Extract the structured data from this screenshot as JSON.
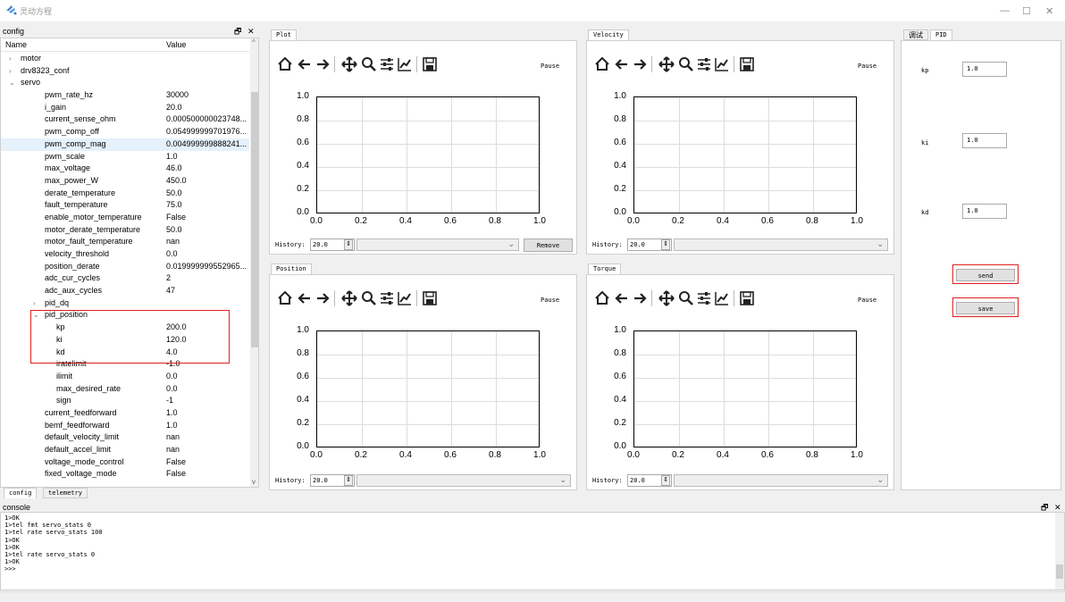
{
  "window": {
    "title": "灵动方程",
    "minimize": "—",
    "maximize": "☐",
    "close": "✕"
  },
  "config": {
    "dock_title": "config",
    "float_icon": "🗗",
    "close_icon": "✕",
    "col_name": "Name",
    "col_value": "Value",
    "rows": [
      {
        "k": "motor",
        "v": "",
        "lvl": 1,
        "arrow": ">"
      },
      {
        "k": "drv8323_conf",
        "v": "",
        "lvl": 1,
        "arrow": ">"
      },
      {
        "k": "servo",
        "v": "",
        "lvl": 1,
        "arrow": "v"
      },
      {
        "k": "pwm_rate_hz",
        "v": "30000",
        "lvl": 2
      },
      {
        "k": "i_gain",
        "v": "20.0",
        "lvl": 2
      },
      {
        "k": "current_sense_ohm",
        "v": "0.000500000023748...",
        "lvl": 2
      },
      {
        "k": "pwm_comp_off",
        "v": "0.054999999701976...",
        "lvl": 2
      },
      {
        "k": "pwm_comp_mag",
        "v": "0.004999999888241...",
        "lvl": 2,
        "sel": true
      },
      {
        "k": "pwm_scale",
        "v": "1.0",
        "lvl": 2
      },
      {
        "k": "max_voltage",
        "v": "46.0",
        "lvl": 2
      },
      {
        "k": "max_power_W",
        "v": "450.0",
        "lvl": 2
      },
      {
        "k": "derate_temperature",
        "v": "50.0",
        "lvl": 2
      },
      {
        "k": "fault_temperature",
        "v": "75.0",
        "lvl": 2
      },
      {
        "k": "enable_motor_temperature",
        "v": "False",
        "lvl": 2
      },
      {
        "k": "motor_derate_temperature",
        "v": "50.0",
        "lvl": 2
      },
      {
        "k": "motor_fault_temperature",
        "v": "nan",
        "lvl": 2
      },
      {
        "k": "velocity_threshold",
        "v": "0.0",
        "lvl": 2
      },
      {
        "k": "position_derate",
        "v": "0.019999999552965...",
        "lvl": 2
      },
      {
        "k": "adc_cur_cycles",
        "v": "2",
        "lvl": 2
      },
      {
        "k": "adc_aux_cycles",
        "v": "47",
        "lvl": 2
      },
      {
        "k": "pid_dq",
        "v": "",
        "lvl": 2,
        "arrow": ">"
      },
      {
        "k": "pid_position",
        "v": "",
        "lvl": 2,
        "arrow": "v"
      },
      {
        "k": "kp",
        "v": "200.0",
        "lvl": 3
      },
      {
        "k": "ki",
        "v": "120.0",
        "lvl": 3
      },
      {
        "k": "kd",
        "v": "4.0",
        "lvl": 3
      },
      {
        "k": "iratelimit",
        "v": "-1.0",
        "lvl": 3
      },
      {
        "k": "ilimit",
        "v": "0.0",
        "lvl": 3
      },
      {
        "k": "max_desired_rate",
        "v": "0.0",
        "lvl": 3
      },
      {
        "k": "sign",
        "v": "-1",
        "lvl": 3
      },
      {
        "k": "current_feedforward",
        "v": "1.0",
        "lvl": 2
      },
      {
        "k": "bemf_feedforward",
        "v": "1.0",
        "lvl": 2
      },
      {
        "k": "default_velocity_limit",
        "v": "nan",
        "lvl": 2
      },
      {
        "k": "default_accel_limit",
        "v": "nan",
        "lvl": 2
      },
      {
        "k": "voltage_mode_control",
        "v": "False",
        "lvl": 2
      },
      {
        "k": "fixed_voltage_mode",
        "v": "False",
        "lvl": 2
      }
    ],
    "tabs": [
      "config",
      "telemetry"
    ]
  },
  "plots": [
    {
      "tab": "Plot",
      "pause": "Pause",
      "history_label": "History:",
      "history_value": "20.0",
      "remove": "Remove"
    },
    {
      "tab": "Velocity",
      "pause": "Pause",
      "history_label": "History:",
      "history_value": "20.0"
    },
    {
      "tab": "Position",
      "pause": "Pause",
      "history_label": "History:",
      "history_value": "20.0"
    },
    {
      "tab": "Torque",
      "pause": "Pause",
      "history_label": "History:",
      "history_value": "20.0"
    }
  ],
  "axis": {
    "yticks": [
      "1.0",
      "0.8",
      "0.6",
      "0.4",
      "0.2",
      "0.0"
    ],
    "xticks": [
      "0.0",
      "0.2",
      "0.4",
      "0.6",
      "0.8",
      "1.0"
    ]
  },
  "toolbar_icons": [
    "home-icon",
    "back-icon",
    "forward-icon",
    "pan-icon",
    "zoom-icon",
    "configure-icon",
    "edit-curves-icon",
    "save-figure-icon"
  ],
  "pid": {
    "tabs": [
      "调试",
      "PID"
    ],
    "kp_label": "kp",
    "kp_value": "1.0",
    "ki_label": "ki",
    "ki_value": "1.0",
    "kd_label": "kd",
    "kd_value": "1.0",
    "send": "send",
    "save": "save"
  },
  "console": {
    "title": "console",
    "lines": "1>OK\n1>tel fmt servo_stats 0\n1>tel rate servo_stats 100\n1>OK\n1>OK\n1>tel rate servo_stats 0\n1>OK\n>>>"
  }
}
